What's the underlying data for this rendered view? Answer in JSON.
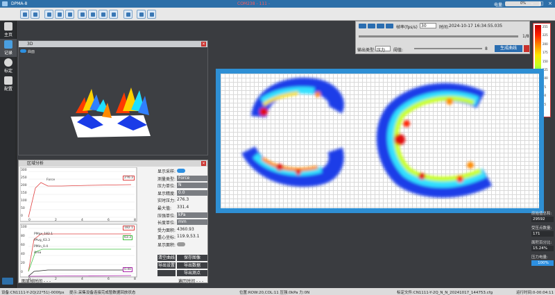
{
  "title": "DPMA-8",
  "com_port": "COM238 - 111 -",
  "battery_label": "电量:",
  "battery_value": "0%",
  "sidebar": {
    "items": [
      {
        "label": "主页"
      },
      {
        "label": "记录"
      },
      {
        "label": "标定"
      },
      {
        "label": "配置"
      }
    ]
  },
  "panel_3d": {
    "title": "3D",
    "toggle_label": "曲面"
  },
  "player": {
    "speed_label": "帧率(fps/s)",
    "speed_value": "30",
    "time_label": "时间:",
    "time_value": "2024-10-17 16:34:55.035",
    "frame_count": "1/8",
    "output_type_label": "输出类型:",
    "output_type_value": "压力",
    "threshold_label": "阈值:",
    "threshold_value": "8",
    "generate_label": "生成曲线"
  },
  "scale": {
    "ticks": [
      "255",
      "225",
      "200",
      "175",
      "150",
      "125",
      "100",
      "75",
      "50",
      "25",
      "1"
    ]
  },
  "analysis": {
    "title": "区域分析",
    "chart1": {
      "legend": "Force",
      "tag": "276.3",
      "y_ticks": [
        "300",
        "250",
        "200",
        "150",
        "100",
        "50",
        "0"
      ],
      "x_ticks": [
        "0",
        "2",
        "4",
        "6",
        "8"
      ]
    },
    "chart2": {
      "legends": [
        "PMax_182.1",
        "PAvg_63.3",
        "PMin_0.4",
        "Area"
      ],
      "tags": [
        "182.1",
        "63.3",
        "0.40"
      ],
      "y_ticks": [
        "100",
        "80",
        "60",
        "40",
        "20",
        "0"
      ],
      "x_ticks": [
        "0",
        "2",
        "4",
        "6",
        "8"
      ]
    },
    "fields": [
      {
        "label": "显示采样:",
        "type": "toggle"
      },
      {
        "label": "测量类型:",
        "value": "Force",
        "type": "box"
      },
      {
        "label": "压力单位:",
        "value": "N",
        "type": "box"
      },
      {
        "label": "显示精度:",
        "value": "0.0",
        "type": "box"
      },
      {
        "label": "实时压力:",
        "value": "276.3",
        "type": "text"
      },
      {
        "label": "最大值:",
        "value": "331.4",
        "type": "text"
      },
      {
        "label": "压强单位:",
        "value": "kPa",
        "type": "box"
      },
      {
        "label": "长度单位:",
        "value": "mm",
        "type": "box"
      },
      {
        "label": "受力面积:",
        "value": "4360.93",
        "type": "text"
      },
      {
        "label": "重心坐标:",
        "value": "119.9,53.1",
        "type": "text"
      },
      {
        "label": "显示面积:",
        "type": "toggle"
      }
    ],
    "buttons": [
      "清空曲线",
      "保存图像",
      "导出设置",
      "导出数据",
      "导出测点"
    ],
    "footer_left": "图显帧时间 - - -",
    "footer_right": "遍历时间 - - -"
  },
  "stats": [
    {
      "label": "原始值总和:",
      "value": "29592"
    },
    {
      "label": "受压点数量:",
      "value": "171"
    },
    {
      "label": "面积百分比:",
      "value": "15.24%"
    },
    {
      "label": "压力电量:",
      "value": "100%"
    }
  ],
  "statusbar": {
    "device": "设备:CN1111-Y-2Q(22*51)-000fps",
    "hint": "提示:采集设备连接完成暂数据回放状态",
    "position": "位置:ROW:20,COL:11 压强:0kPa 力:0N",
    "file": "标定文件:CN1111-Y-2Q_N_N_20241017_144753.cfg",
    "runtime": "运行时间:0-00:04:11"
  }
}
